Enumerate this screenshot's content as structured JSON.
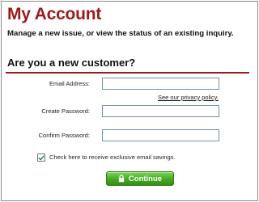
{
  "header": {
    "title": "My Account",
    "subtitle": "Manage a new issue, or view the status of an existing inquiry."
  },
  "section": {
    "title": "Are you a new customer?"
  },
  "form": {
    "email_label": "Email Address:",
    "email_value": "",
    "privacy_link": "See our privacy policy.",
    "create_password_label": "Create Password:",
    "create_password_value": "",
    "confirm_password_label": "Confirm Password:",
    "confirm_password_value": "",
    "email_savings_label": "Check here to receive exclusive email savings.",
    "email_savings_checked": true,
    "continue_label": "Continue"
  },
  "colors": {
    "title": "#9b1b1b",
    "divider": "#9b1b1b",
    "button": "#45a922",
    "field_border": "#6f8fb4"
  },
  "icons": {
    "checkbox_mark": "checkmark-icon",
    "button_icon": "lock-icon"
  }
}
